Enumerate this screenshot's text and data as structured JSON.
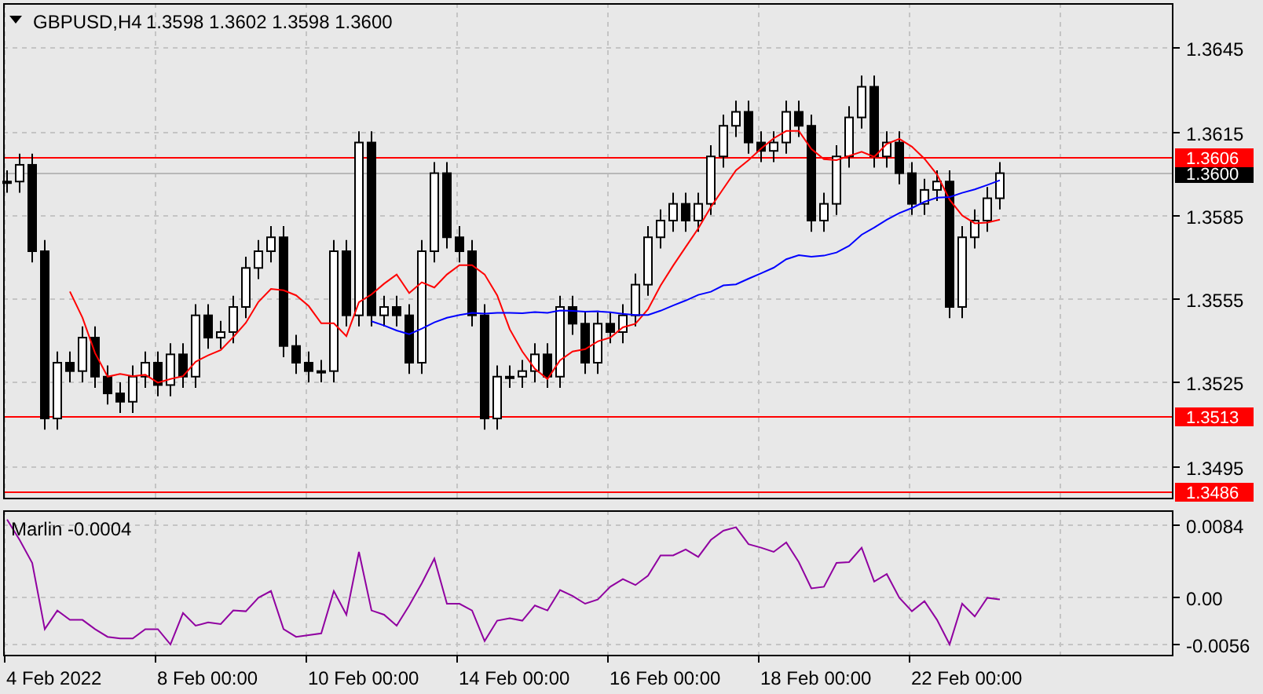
{
  "main_chart": {
    "symbol": "GBPUSD,H4",
    "quote": "1.3598 1.3602 1.3598 1.3600",
    "price_axis": [
      "1.3645",
      "1.3615",
      "1.3585",
      "1.3555",
      "1.3525",
      "1.3495"
    ],
    "price_tags": [
      {
        "label": "1.3606",
        "color": "#ff0000"
      },
      {
        "label": "1.3600",
        "color": "#000000"
      },
      {
        "label": "1.3513",
        "color": "#ff0000"
      },
      {
        "label": "1.3486",
        "color": "#ff0000"
      }
    ]
  },
  "indicator": {
    "chart_data": {
      "type": "line",
      "title": "Marlin -0.0004",
      "grid": true,
      "ylim": [
        -0.0071,
        0.0101
      ],
      "yticks": [
        {
          "value": 0.0084,
          "label": "0.0084"
        },
        {
          "value": 0,
          "label": "0.00"
        },
        {
          "value": -0.0056,
          "label": "-0.0056"
        }
      ],
      "series": [
        {
          "color": "#9000a0",
          "values": [
            0.009,
            0.0066,
            0.0039,
            -0.0039,
            -0.0017,
            -0.0028,
            -0.0028,
            -0.0039,
            -0.0048,
            -0.005,
            -0.005,
            -0.0039,
            -0.0039,
            -0.0057,
            -0.002,
            -0.0035,
            -0.0031,
            -0.0033,
            -0.0017,
            -0.0018,
            -0.0002,
            0.0006,
            -0.0039,
            -0.0048,
            -0.0046,
            -0.0044,
            0.0006,
            -0.0022,
            0.0052,
            -0.0017,
            -0.0022,
            -0.0035,
            -0.0011,
            0.0015,
            0.0044,
            -0.0009,
            -0.0009,
            -0.0017,
            -0.0053,
            -0.0029,
            -0.0026,
            -0.0029,
            -0.0011,
            -0.0017,
            0.0007,
            0,
            -0.0009,
            -0.0004,
            0.0011,
            0.002,
            0.0013,
            0.0024,
            0.0048,
            0.0048,
            0.0055,
            0.0046,
            0.0066,
            0.0077,
            0.0081,
            0.0061,
            0.0057,
            0.0052,
            0.0063,
            0.004,
            0.0009,
            0.0011,
            0.0039,
            0.004,
            0.0057,
            0.0017,
            0.0026,
            -0.0002,
            -0.0018,
            -0.0006,
            -0.0028,
            -0.0057,
            -0.0009,
            -0.0024,
            -0.0002,
            -0.0004
          ]
        }
      ]
    }
  },
  "time_axis": {
    "labels": [
      "4 Feb 2022",
      "8 Feb 00:00",
      "10 Feb 00:00",
      "14 Feb 00:00",
      "16 Feb 00:00",
      "18 Feb 00:00",
      "22 Feb 00:00"
    ]
  }
}
